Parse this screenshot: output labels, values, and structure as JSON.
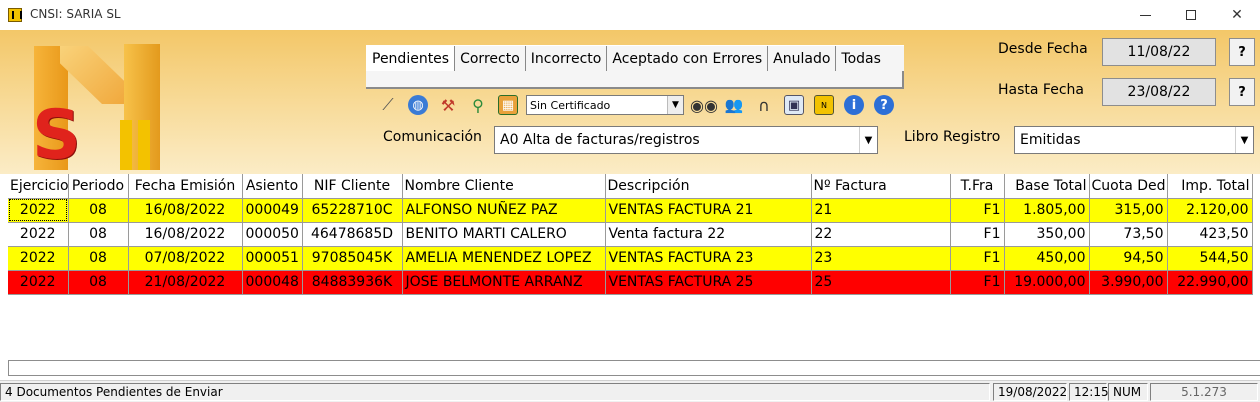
{
  "window": {
    "title": "CNSI: SARIA SL"
  },
  "tabs": [
    {
      "label": "Pendientes",
      "active": true
    },
    {
      "label": "Correcto",
      "active": false
    },
    {
      "label": "Incorrecto",
      "active": false
    },
    {
      "label": "Aceptado con Errores",
      "active": false
    },
    {
      "label": "Anulado",
      "active": false
    },
    {
      "label": "Todas",
      "active": false
    }
  ],
  "toolbar": {
    "icons": [
      "wand-icon",
      "globe-icon",
      "tools-icon",
      "search-zoom-icon",
      "calendar-grid-icon",
      "binoculars-icon",
      "users-icon",
      "headset-icon",
      "id-card-icon",
      "news-icon",
      "info-icon",
      "help-icon"
    ],
    "certificate_value": "Sin Certificado"
  },
  "filters": {
    "comunicacion_label": "Comunicación",
    "comunicacion_value": "A0 Alta de facturas/registros",
    "libro_label": "Libro Registro",
    "libro_value": "Emitidas",
    "desde_label": "Desde Fecha",
    "desde_value": "11/08/22",
    "hasta_label": "Hasta Fecha",
    "hasta_value": "23/08/22",
    "help_glyph": "?"
  },
  "table": {
    "columns": [
      "Ejercicio",
      "Periodo",
      "Fecha Emisión",
      "Asiento",
      "NIF Cliente",
      "Nombre Cliente",
      "Descripción",
      "Nº Factura",
      "T.Fra",
      "Base Total",
      "Cuota Ded.",
      "Imp. Total"
    ],
    "rows": [
      {
        "color": "yellow",
        "cells": [
          "2022",
          "08",
          "16/08/2022",
          "000049",
          "65228710C",
          "ALFONSO NUÑEZ PAZ",
          "VENTAS FACTURA 21",
          "21",
          "F1",
          "1.805,00",
          "315,00",
          "2.120,00"
        ]
      },
      {
        "color": "white",
        "cells": [
          "2022",
          "08",
          "16/08/2022",
          "000050",
          "46478685D",
          "BENITO MARTI CALERO",
          "Venta factura 22",
          "22",
          "F1",
          "350,00",
          "73,50",
          "423,50"
        ]
      },
      {
        "color": "yellow",
        "cells": [
          "2022",
          "08",
          "07/08/2022",
          "000051",
          "97085045K",
          "AMELIA MENENDEZ LOPEZ",
          "VENTAS FACTURA 23",
          "23",
          "F1",
          "450,00",
          "94,50",
          "544,50"
        ]
      },
      {
        "color": "red",
        "cells": [
          "2022",
          "08",
          "21/08/2022",
          "000048",
          "84883936K",
          "JOSE BELMONTE ARRANZ",
          "VENTAS FACTURA 25",
          "25",
          "F1",
          "19.000,00",
          "3.990,00",
          "22.990,00"
        ]
      }
    ]
  },
  "statusbar": {
    "message": "4 Documentos Pendientes de Enviar",
    "date": "19/08/2022",
    "time": "12:15",
    "num": "NUM",
    "version": "5.1.273"
  },
  "colors": {
    "row_yellow": "#ffff00",
    "row_red": "#ff0000",
    "header_band": "#f3c768"
  }
}
